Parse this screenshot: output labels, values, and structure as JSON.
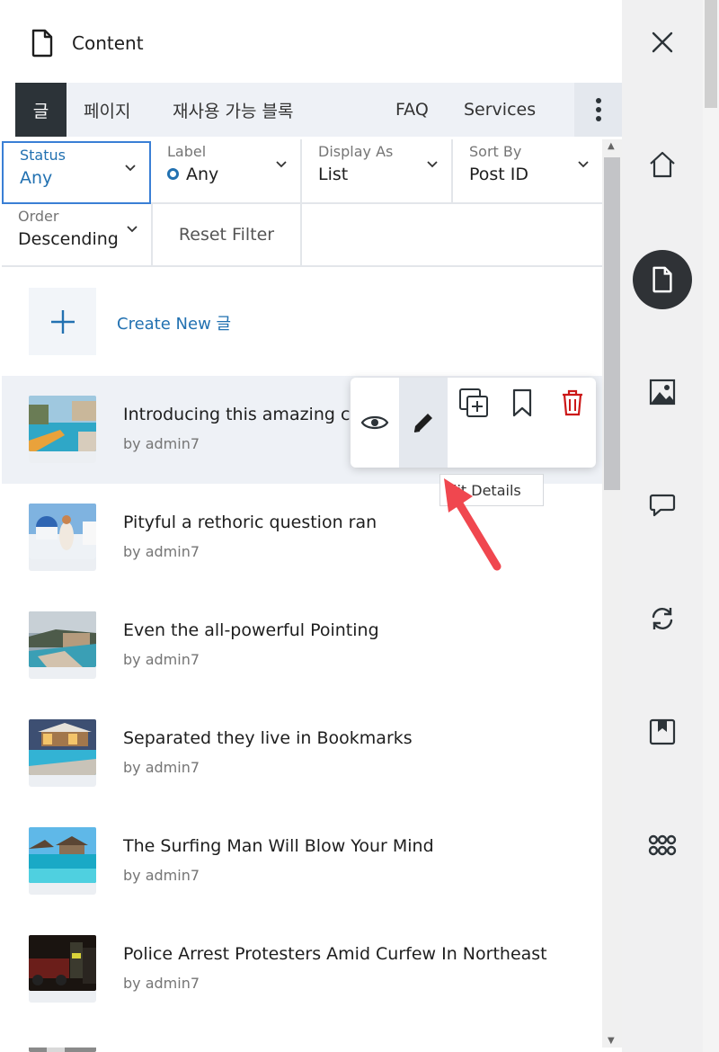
{
  "panel": {
    "title": "Content"
  },
  "tabs": [
    {
      "label": "글"
    },
    {
      "label": "페이지"
    },
    {
      "label": "재사용 가능 블록"
    },
    {
      "label": "FAQ"
    },
    {
      "label": "Services"
    }
  ],
  "filters": {
    "status": {
      "label": "Status",
      "value": "Any"
    },
    "label": {
      "label": "Label",
      "value": "Any"
    },
    "display_as": {
      "label": "Display As",
      "value": "List"
    },
    "sort_by": {
      "label": "Sort By",
      "value": "Post ID"
    },
    "order": {
      "label": "Order",
      "value": "Descending"
    },
    "reset": "Reset Filter"
  },
  "create": {
    "label": "Create New 글"
  },
  "posts": [
    {
      "title": "Introducing this amazing c",
      "author": "by admin7"
    },
    {
      "title": "Pityful a rethoric question ran",
      "author": "by admin7"
    },
    {
      "title": "Even the all-powerful Pointing",
      "author": "by admin7"
    },
    {
      "title": "Separated they live in Bookmarks",
      "author": "by admin7"
    },
    {
      "title": "The Surfing Man Will Blow Your Mind",
      "author": "by admin7"
    },
    {
      "title": "Police Arrest Protesters Amid Curfew In Northeast",
      "author": "by admin7"
    }
  ],
  "tooltip": {
    "text": "lit Details"
  },
  "rail_icons": [
    "home-icon",
    "document-icon",
    "image-icon",
    "comment-icon",
    "sync-icon",
    "bookmark-icon",
    "apps-grid-icon"
  ],
  "colors": {
    "accent": "#2271b1",
    "dark": "#2c3338",
    "delete": "#cc1818",
    "arrow": "#f0474f"
  }
}
